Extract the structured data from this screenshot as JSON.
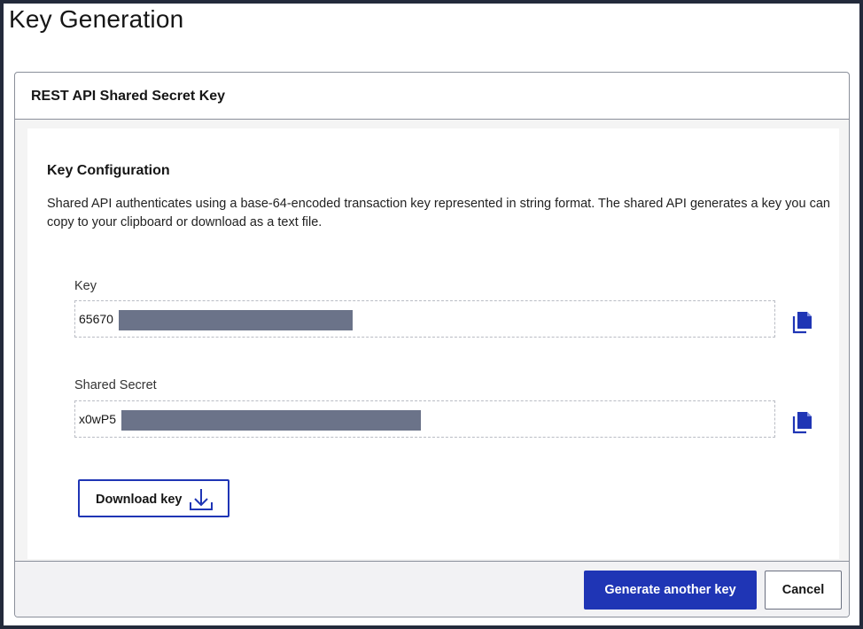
{
  "page": {
    "title": "Key Generation"
  },
  "panel": {
    "header_title": "REST API Shared Secret Key",
    "section_title": "Key Configuration",
    "description": "Shared API authenticates using a base-64-encoded transaction key represented in string format. The shared API generates a key you can copy to your clipboard or download as a text file."
  },
  "fields": {
    "key": {
      "label": "Key",
      "value_visible": "65670",
      "redacted": true,
      "copy_icon": "copy-icon"
    },
    "shared_secret": {
      "label": "Shared Secret",
      "value_visible": "x0wP5",
      "redacted": true,
      "copy_icon": "copy-icon"
    }
  },
  "actions": {
    "download_label": "Download key",
    "download_icon": "download-icon",
    "generate_label": "Generate another key",
    "cancel_label": "Cancel"
  },
  "colors": {
    "accent": "#1f35b5",
    "redaction": "#6b7389",
    "footer_bg": "#f2f2f4",
    "body_bg": "#f4f4f4"
  }
}
